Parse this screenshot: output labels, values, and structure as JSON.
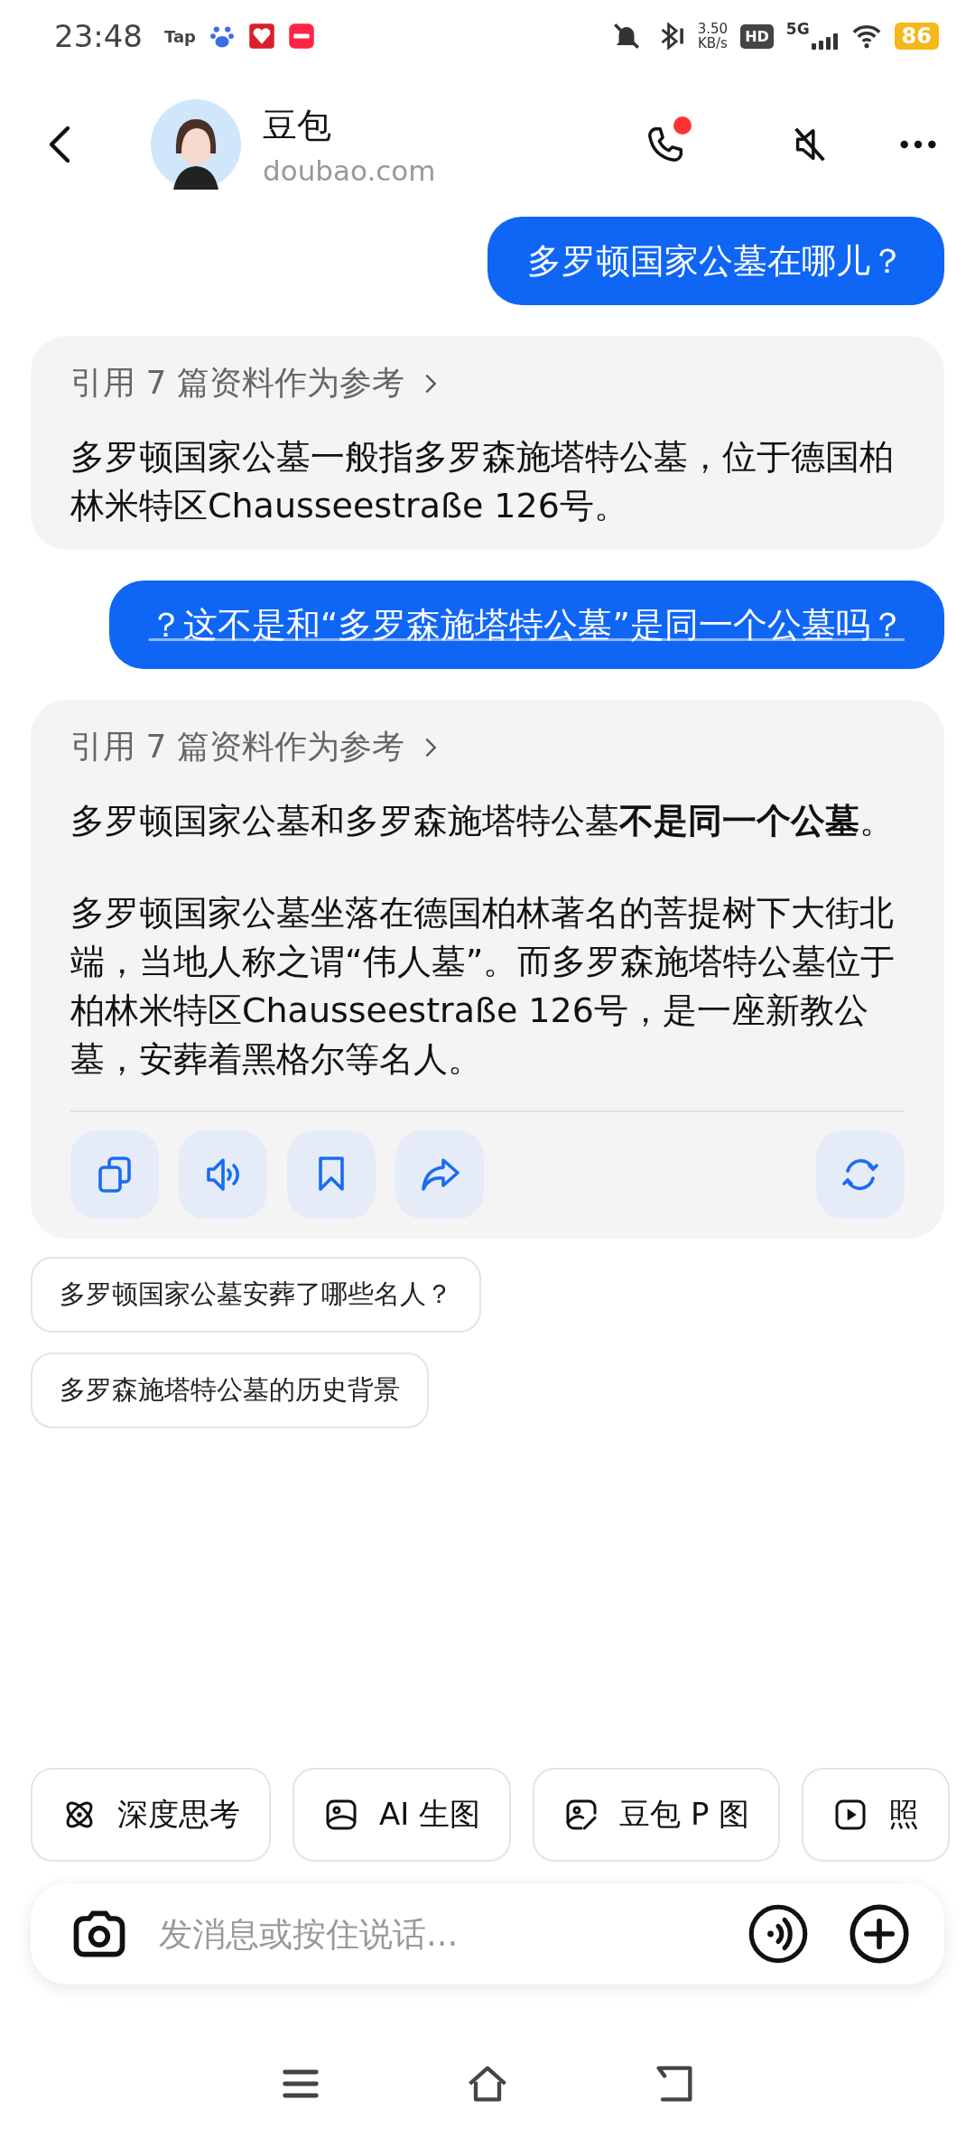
{
  "status_bar": {
    "time": "23:48",
    "tap_label": "Tap",
    "speed_value": "3.50",
    "speed_unit": "KB/s",
    "hd_label": "HD",
    "network": "5G",
    "battery": "86"
  },
  "header": {
    "name": "豆包",
    "domain": "doubao.com",
    "call_badge": true
  },
  "messages": [
    {
      "kind": "user",
      "text": "多罗顿国家公墓在哪儿？",
      "underlined": false
    },
    {
      "kind": "bot",
      "citation": "引用 7 篇资料作为参考",
      "paragraphs": [
        "多罗顿国家公墓一般指多罗森施塔特公墓，位于德国柏林米特区Chausseestraße 126号。"
      ],
      "actions": false
    },
    {
      "kind": "user",
      "text": "？这不是和“多罗森施塔特公墓”是同一个公墓吗？",
      "underlined": true
    },
    {
      "kind": "bot",
      "citation": "引用 7 篇资料作为参考",
      "paragraphs": [
        "多罗顿国家公墓和多罗森施塔特公墓**不是同一个公墓**。",
        "多罗顿国家公墓坐落在德国柏林著名的菩提树下大街北端，当地人称之谓“伟人墓”。而多罗森施塔特公墓位于柏林米特区Chausseestraße 126号，是一座新教公墓，安葬着黑格尔等名人。"
      ],
      "actions": true
    }
  ],
  "suggestions": [
    "多罗顿国家公墓安葬了哪些名人？",
    "多罗森施塔特公墓的历史背景"
  ],
  "tools": [
    {
      "kind": "atom",
      "label": "深度思考"
    },
    {
      "kind": "image",
      "label": "AI 生图"
    },
    {
      "kind": "image-edit",
      "label": "豆包 P 图"
    },
    {
      "kind": "play",
      "label": "照"
    }
  ],
  "input": {
    "placeholder": "发消息或按住说话..."
  }
}
